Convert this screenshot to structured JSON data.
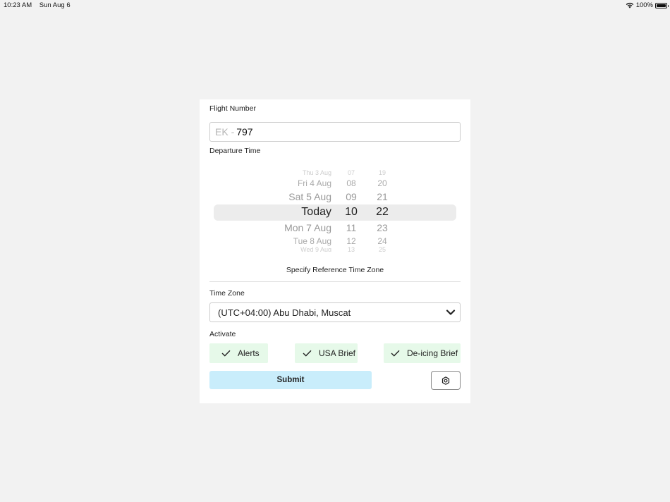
{
  "status_bar": {
    "time": "10:23 AM",
    "date": "Sun Aug 6",
    "battery": "100%"
  },
  "form": {
    "flight_number_label": "Flight Number",
    "flight_prefix": "EK -",
    "flight_value": "797",
    "departure_label": "Departure Time",
    "picker": {
      "dates": [
        "Thu 3 Aug",
        "Fri 4 Aug",
        "Sat 5 Aug",
        "Today",
        "Mon 7 Aug",
        "Tue 8 Aug",
        "Wed 9 Aug"
      ],
      "hours": [
        "07",
        "08",
        "09",
        "10",
        "11",
        "12",
        "13"
      ],
      "minutes": [
        "19",
        "20",
        "21",
        "22",
        "23",
        "24",
        "25"
      ]
    },
    "reference_tz_link": "Specify Reference Time Zone",
    "timezone_label": "Time Zone",
    "timezone_value": "(UTC+04:00) Abu Dhabi, Muscat",
    "activate_label": "Activate",
    "toggles": {
      "alerts": "Alerts",
      "usa_brief": "USA Brief",
      "deicing_brief": "De-icing Brief"
    },
    "submit_label": "Submit"
  }
}
